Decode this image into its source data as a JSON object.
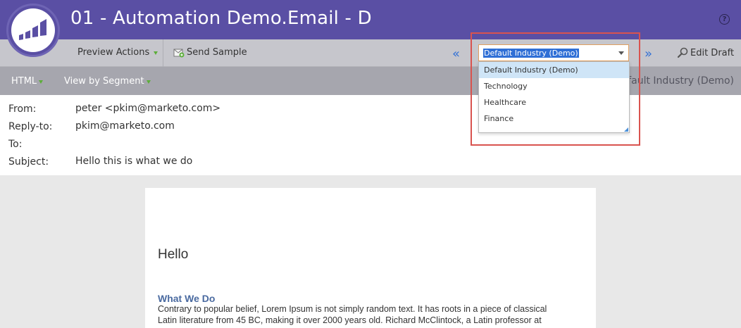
{
  "app": {
    "title": "01 - Automation Demo.Email - D",
    "help_icon": "?"
  },
  "toolbar": {
    "preview_actions": "Preview Actions",
    "send_sample": "Send Sample",
    "edit_draft": "Edit Draft"
  },
  "tabs": {
    "html": "HTML",
    "view_by_segment": "View by Segment",
    "segment_right": "Default Industry (Demo)"
  },
  "segment_select": {
    "selected": "Default Industry (Demo)",
    "options": [
      "Default Industry (Demo)",
      "Technology",
      "Healthcare",
      "Finance"
    ]
  },
  "email_header": {
    "from_label": "From:",
    "from_value": "peter <pkim@marketo.com>",
    "reply_label": "Reply-to:",
    "reply_value": "pkim@marketo.com",
    "to_label": "To:",
    "to_value": "",
    "subject_label": "Subject:",
    "subject_value": "Hello this is what we do"
  },
  "email_body": {
    "greeting": "Hello",
    "section_title": "What We Do",
    "paragraph_line1": "Contrary to popular belief, Lorem Ipsum is not simply random text. It has roots in a piece of classical",
    "paragraph_line2": "Latin literature from 45 BC, making it over 2000 years old. Richard McClintock, a Latin professor at"
  },
  "colors": {
    "brand": "#5a4fa4",
    "highlight": "#d9534f",
    "accent_blue": "#2f6fd6",
    "menu_arrow": "#5cae3a"
  }
}
